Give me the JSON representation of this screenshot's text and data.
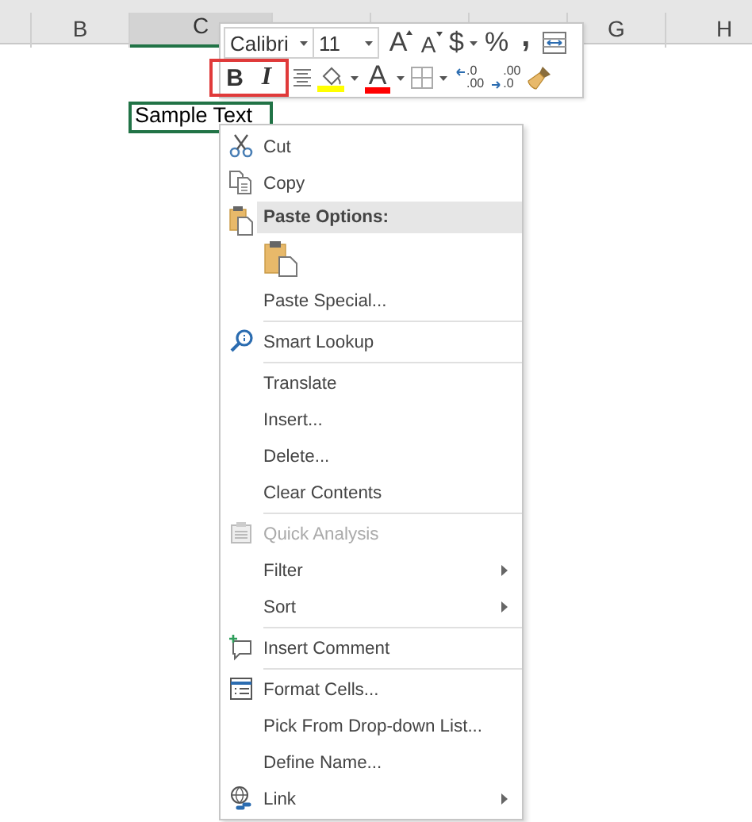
{
  "sheet": {
    "columns": [
      {
        "label": "B",
        "selected": false,
        "covered": false
      },
      {
        "label": "C",
        "selected": true,
        "covered": false
      },
      {
        "covered": true
      },
      {
        "covered": true
      },
      {
        "covered": true
      },
      {
        "label": "G",
        "selected": false,
        "covered": false
      },
      {
        "label": "H",
        "selected": false,
        "covered": false
      }
    ],
    "active_cell": {
      "value": "Sample Text"
    }
  },
  "mini_toolbar": {
    "font_box": {
      "value": "Calibri"
    },
    "size_box": {
      "value": "11"
    },
    "row1": [
      {
        "kind": "grow",
        "label": "A",
        "dropdown": false
      },
      {
        "kind": "shrink",
        "label": "A",
        "dropdown": false
      },
      {
        "kind": "currency",
        "label": "$",
        "dropdown": true
      },
      {
        "kind": "percent",
        "label": "%",
        "dropdown": false
      },
      {
        "kind": "comma",
        "label": ",",
        "dropdown": false
      },
      {
        "kind": "wrap",
        "dropdown": false
      }
    ],
    "marked_group": {
      "outlined": true,
      "buttons": [
        {
          "kind": "bold",
          "label": "B"
        },
        {
          "kind": "italic",
          "label": "I"
        }
      ]
    },
    "row2": [
      {
        "kind": "align",
        "dropdown": false
      },
      {
        "kind": "fill",
        "color": "#ffff00",
        "dropdown": true
      },
      {
        "kind": "font-color",
        "label": "A",
        "color": "#ff0000",
        "dropdown": true
      },
      {
        "kind": "borders",
        "dropdown": true
      },
      {
        "kind": "increase-decimal",
        "top": ".0",
        "bottom": ".00",
        "dropdown": false
      },
      {
        "kind": "decrease-decimal",
        "top": ".00",
        "bottom": ".0",
        "dropdown": false
      },
      {
        "kind": "painter",
        "dropdown": false
      }
    ]
  },
  "context_menu": [
    {
      "kind": "cut",
      "label": "Cut",
      "disabled": false,
      "submenu": false
    },
    {
      "kind": "copy",
      "label": "Copy",
      "disabled": false,
      "submenu": false
    },
    {
      "kind": "header",
      "label": "Paste Options:"
    },
    {
      "kind": "paste-options"
    },
    {
      "kind": "plain",
      "label": "Paste Special...",
      "disabled": false,
      "submenu": false
    },
    {
      "kind": "separator"
    },
    {
      "kind": "lookup",
      "label": "Smart Lookup",
      "disabled": false,
      "submenu": false
    },
    {
      "kind": "separator"
    },
    {
      "kind": "plain",
      "label": "Translate",
      "disabled": false,
      "submenu": false
    },
    {
      "kind": "plain",
      "label": "Insert...",
      "disabled": false,
      "submenu": false
    },
    {
      "kind": "plain",
      "label": "Delete...",
      "disabled": false,
      "submenu": false
    },
    {
      "kind": "plain",
      "label": "Clear Contents",
      "disabled": false,
      "submenu": false
    },
    {
      "kind": "separator"
    },
    {
      "kind": "quick",
      "label": "Quick Analysis",
      "disabled": true,
      "submenu": false
    },
    {
      "kind": "plain",
      "label": "Filter",
      "disabled": false,
      "submenu": true
    },
    {
      "kind": "plain",
      "label": "Sort",
      "disabled": false,
      "submenu": true
    },
    {
      "kind": "separator"
    },
    {
      "kind": "comment",
      "label": "Insert Comment",
      "disabled": false,
      "submenu": false
    },
    {
      "kind": "separator"
    },
    {
      "kind": "format",
      "label": "Format Cells...",
      "disabled": false,
      "submenu": false
    },
    {
      "kind": "plain",
      "label": "Pick From Drop-down List...",
      "disabled": false,
      "submenu": false
    },
    {
      "kind": "plain",
      "label": "Define Name...",
      "disabled": false,
      "submenu": false
    },
    {
      "kind": "link",
      "label": "Link",
      "disabled": false,
      "submenu": true
    }
  ]
}
